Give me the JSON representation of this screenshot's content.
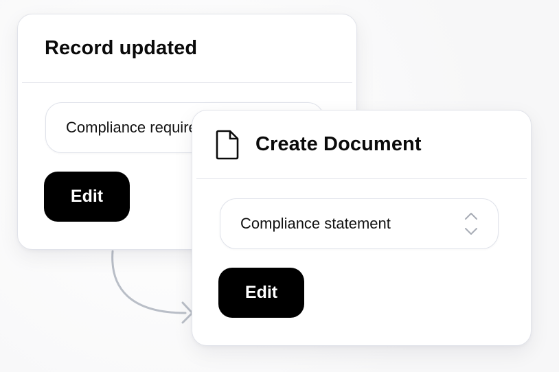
{
  "colors": {
    "background": "#fafafa",
    "card": "#ffffff",
    "border": "#e1e3ea",
    "button": "#000000",
    "button_text": "#ffffff",
    "connector": "#b9bec7"
  },
  "record_card": {
    "title": "Record updated",
    "field_value": "Compliance requirement",
    "edit_label": "Edit"
  },
  "create_card": {
    "icon": "document-icon",
    "title": "Create Document",
    "select_value": "Compliance statement",
    "select_icon": "chevron-up-down-icon",
    "edit_label": "Edit"
  },
  "connector": {
    "icon": "arrow-right-icon"
  }
}
